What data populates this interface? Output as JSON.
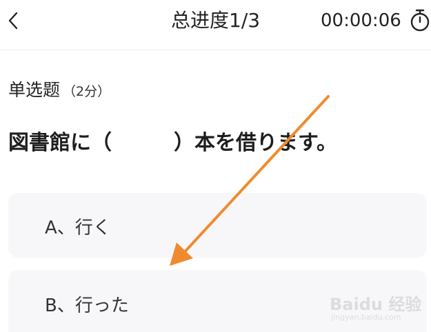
{
  "header": {
    "back_icon": "chevron-left-icon",
    "progress_title": "总进度1/3",
    "timer": "00:00:06",
    "timer_icon": "stopwatch-icon"
  },
  "question": {
    "type_label": "单选题",
    "score_label": "（2分）",
    "text": "図書館に（　　　）本を借ります。"
  },
  "options": [
    {
      "label": "A、行く"
    },
    {
      "label": "B、行った"
    }
  ],
  "annotation": {
    "arrow_color": "#F08A2E"
  },
  "watermark": {
    "main": "Baidu 经验",
    "sub": "jingyan.baidu.com"
  }
}
